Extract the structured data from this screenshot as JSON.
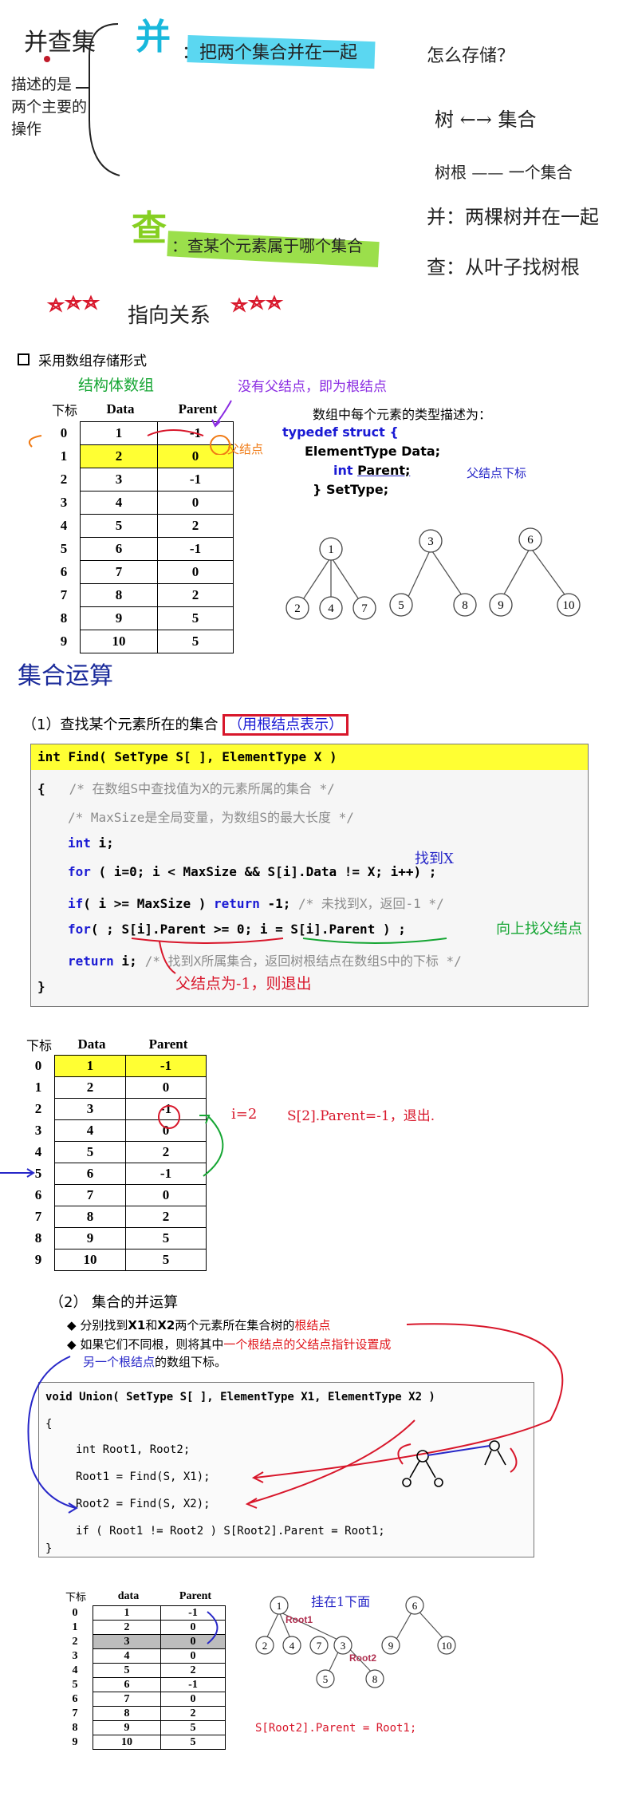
{
  "notes": {
    "left_vertical": "并查集",
    "desc": [
      "描述的是",
      "两个主要的",
      "操作"
    ],
    "union_char": "并",
    "union_desc": "：把两个集合并在一起",
    "find_char": "查",
    "find_desc": "：查某个元素属于哪个集合",
    "how_store": "怎么存储？",
    "tree_set": "树 ←→ 集合",
    "root_set": "树根 —— 一个集合",
    "union_trees": "并：两棵树并在一起",
    "find_leaf": "查：从叶子找树根",
    "pointer": "指向关系"
  },
  "storage": {
    "heading": "采用数组存储形式",
    "struct_note": "结构体数组",
    "no_parent_note": "没有父结点，即为根结点",
    "parent_note": "父结点",
    "col_index": "下标",
    "col_data": "Data",
    "col_parent": "Parent",
    "rows": [
      {
        "i": "0",
        "d": "1",
        "p": "-1"
      },
      {
        "i": "1",
        "d": "2",
        "p": "0"
      },
      {
        "i": "2",
        "d": "3",
        "p": "-1"
      },
      {
        "i": "3",
        "d": "4",
        "p": "0"
      },
      {
        "i": "4",
        "d": "5",
        "p": "2"
      },
      {
        "i": "5",
        "d": "6",
        "p": "-1"
      },
      {
        "i": "6",
        "d": "7",
        "p": "0"
      },
      {
        "i": "7",
        "d": "8",
        "p": "2"
      },
      {
        "i": "8",
        "d": "9",
        "p": "5"
      },
      {
        "i": "9",
        "d": "10",
        "p": "5"
      }
    ],
    "desc_title": "数组中每个元素的类型描述为：",
    "struct_line1": "typedef struct {",
    "struct_line2": "ElementType Data;",
    "struct_line3_kw": "int",
    "struct_line3": "Parent;",
    "struct_line3_note": "父结点下标",
    "struct_line4": "} SetType;",
    "trees": [
      "1",
      "2",
      "4",
      "7",
      "3",
      "5",
      "8",
      "6",
      "9",
      "10"
    ]
  },
  "section_title": "集合运算",
  "find": {
    "heading": "（1）查找某个元素所在的集合",
    "heading_box": "（用根结点表示）",
    "code": {
      "l1": "int Find( SetType S[ ], ElementType X )",
      "l2a": "{",
      "l2b": "/* 在数组S中查找值为X的元素所属的集合 */",
      "l3": "/* MaxSize是全局变量，为数组S的最大长度 */",
      "l4a": "int",
      "l4b": " i;",
      "l5a": "for",
      "l5b": " ( i=0; i < MaxSize && S[i].Data != X; i++) ;",
      "l6a": "if",
      "l6b": "( i >= MaxSize ) ",
      "l6c": "return",
      "l6d": " -1; ",
      "l6e": "/* 未找到X，返回-1 */",
      "l7a": "for",
      "l7b": "( ; S[i].Parent >= 0; i = S[i].Parent ) ;",
      "l8a": "return",
      "l8b": " i;",
      "l8c": "/* 找到X所属集合，返回树根结点在数组S中的下标 */",
      "l9": "}"
    },
    "note_found": "找到X",
    "note_up": "向上找父结点",
    "note_exit": "父结点为-1，则退出",
    "note_i2": "i=2",
    "note_s2": "S[2].Parent=-1，退出."
  },
  "union": {
    "heading": "（2）  集合的并运算",
    "bullet1a": "分别找到",
    "bullet1b": "X1",
    "bullet1c": "和",
    "bullet1d": "X2",
    "bullet1e": "两个元素所在集合树的",
    "bullet1f": "根结点",
    "bullet2a": "如果它们不同根，则将其中",
    "bullet2b": "一个根结点的父结点指针设置成",
    "bullet2c": "另一个根结点",
    "bullet2d": "的数组下标。",
    "code": {
      "l1": "void Union( SetType S[ ], ElementType X1, ElementType X2 )",
      "l2": "{",
      "l3": "int Root1, Root2;",
      "l4": "Root1 = Find(S, X1);",
      "l5": "Root2 = Find(S, X2);",
      "l6": "if ( Root1 != Root2 ) S[Root2].Parent = Root1;",
      "l7": "}"
    },
    "table_head": [
      "下标",
      "data",
      "Parent"
    ],
    "rows": [
      {
        "i": "0",
        "d": "1",
        "p": "-1"
      },
      {
        "i": "1",
        "d": "2",
        "p": "0"
      },
      {
        "i": "2",
        "d": "3",
        "p": "0"
      },
      {
        "i": "3",
        "d": "4",
        "p": "0"
      },
      {
        "i": "4",
        "d": "5",
        "p": "2"
      },
      {
        "i": "5",
        "d": "6",
        "p": "-1"
      },
      {
        "i": "6",
        "d": "7",
        "p": "0"
      },
      {
        "i": "7",
        "d": "8",
        "p": "2"
      },
      {
        "i": "8",
        "d": "9",
        "p": "5"
      },
      {
        "i": "9",
        "d": "10",
        "p": "5"
      }
    ],
    "hang_note": "挂在1下面",
    "root1": "Root1",
    "root2": "Root2",
    "assign": "S[Root2].Parent = Root1;"
  }
}
